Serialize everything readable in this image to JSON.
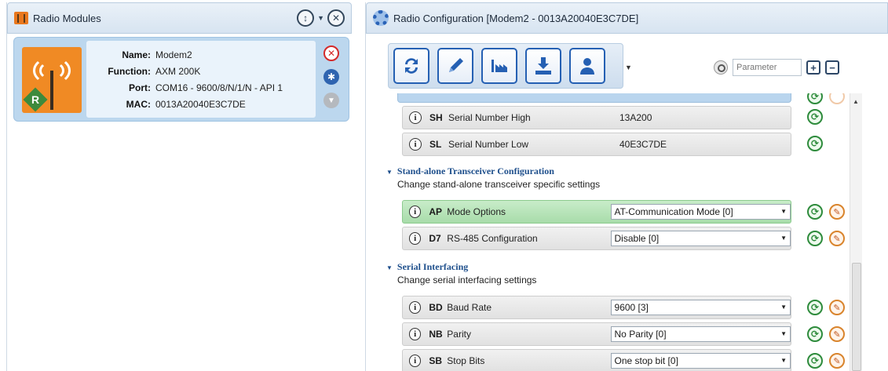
{
  "left_panel": {
    "title": "Radio Modules",
    "sort_icon_label": "↕",
    "module": {
      "name_label": "Name:",
      "name": "Modem2",
      "function_label": "Function:",
      "function": "AXM 200K",
      "port_label": "Port:",
      "port": "COM16 - 9600/8/N/1/N - API 1",
      "mac_label": "MAC:",
      "mac": "0013A20040E3C7DE",
      "badge_letter": "R"
    }
  },
  "right_panel": {
    "title": "Radio Configuration [Modem2 - 0013A20040E3C7DE]",
    "search_placeholder": "Parameter",
    "params_top": [
      {
        "code": "SH",
        "name": "Serial Number High",
        "value": "13A200"
      },
      {
        "code": "SL",
        "name": "Serial Number Low",
        "value": "40E3C7DE"
      }
    ],
    "sections": [
      {
        "title": "Stand-alone Transceiver Configuration",
        "desc": "Change stand-alone transceiver specific settings",
        "params": [
          {
            "code": "AP",
            "name": "Mode Options",
            "value": "AT-Communication Mode [0]"
          },
          {
            "code": "D7",
            "name": "RS-485 Configuration",
            "value": "Disable [0]"
          }
        ]
      },
      {
        "title": "Serial Interfacing",
        "desc": "Change serial interfacing settings",
        "params": [
          {
            "code": "BD",
            "name": "Baud Rate",
            "value": "9600 [3]"
          },
          {
            "code": "NB",
            "name": "Parity",
            "value": "No Parity [0]"
          },
          {
            "code": "SB",
            "name": "Stop Bits",
            "value": "One stop bit [0]"
          }
        ]
      }
    ]
  },
  "colors": {
    "accent_blue": "#2560b3",
    "highlight_green": "#a8dcaa",
    "module_orange": "#f08a24"
  }
}
